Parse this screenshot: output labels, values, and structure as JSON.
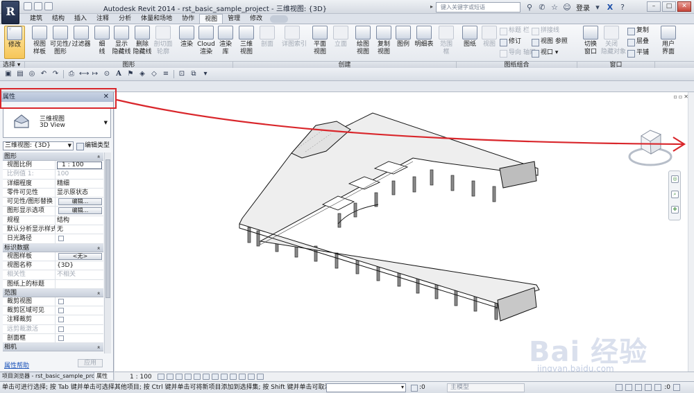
{
  "title": {
    "text": "Autodesk Revit 2014 -     rst_basic_sample_project - 三维视图: {3D}",
    "search_placeholder": "键入关键字或短语",
    "login": "登录"
  },
  "tabs": [
    "建筑",
    "结构",
    "插入",
    "注释",
    "分析",
    "体量和场地",
    "协作",
    "视图",
    "管理",
    "修改"
  ],
  "active_tab": "视图",
  "ribbon": {
    "select": {
      "modify": "修改",
      "dropdown": "选择 ▾"
    },
    "graphics": {
      "buttons": [
        "视图\n样板",
        "可见性/\n图形",
        "过滤器",
        "细\n线",
        "显示\n隐藏线",
        "删除\n隐藏线",
        "剖切面\n轮廓",
        "渲染",
        "Cloud\n渲染",
        "渲染\n库"
      ],
      "label": "图形"
    },
    "create": {
      "buttons": [
        "三维\n视图",
        "剖面",
        "详图索引",
        "平面\n视图",
        "立面",
        "绘图\n视图",
        "复制\n视图",
        "图例",
        "明细表",
        "范围\n框"
      ],
      "label": "创建"
    },
    "sheet": {
      "big": [
        "图纸",
        "视图"
      ],
      "small": [
        "标题 栏",
        "修订",
        "导向 轴网",
        "拼接线",
        "视图 参照",
        "视口 ▾"
      ],
      "label": "图纸组合"
    },
    "window": {
      "big": [
        "切换\n窗口",
        "关闭\n隐藏对象"
      ],
      "small": [
        "复制",
        "层叠",
        "平铺"
      ],
      "label": "窗口"
    },
    "user": {
      "label": "用户\n界面"
    }
  },
  "properties": {
    "title": "属性",
    "type_name_cn": "三维视图",
    "type_name_en": "3D View",
    "view_selector": "三维视图: {3D}",
    "edit_type": "编辑类型",
    "sections": [
      {
        "name": "图形",
        "rows": [
          {
            "k": "视图比例",
            "v": "1 : 100",
            "kind": "input"
          },
          {
            "k": "比例值 1:",
            "v": "100",
            "kind": "dim"
          },
          {
            "k": "详细程度",
            "v": "精细"
          },
          {
            "k": "零件可见性",
            "v": "显示原状态"
          },
          {
            "k": "可见性/图形替换",
            "v": "编辑...",
            "kind": "button"
          },
          {
            "k": "图形显示选项",
            "v": "编辑...",
            "kind": "button"
          },
          {
            "k": "规程",
            "v": "结构"
          },
          {
            "k": "默认分析显示样式",
            "v": "无"
          },
          {
            "k": "日光路径",
            "v": "",
            "kind": "check"
          }
        ]
      },
      {
        "name": "标识数据",
        "rows": [
          {
            "k": "视图样板",
            "v": "<无>",
            "kind": "button"
          },
          {
            "k": "视图名称",
            "v": "{3D}"
          },
          {
            "k": "相关性",
            "v": "不相关",
            "kind": "dim"
          },
          {
            "k": "图纸上的标题",
            "v": ""
          }
        ]
      },
      {
        "name": "范围",
        "rows": [
          {
            "k": "裁剪视图",
            "v": "",
            "kind": "check"
          },
          {
            "k": "裁剪区域可见",
            "v": "",
            "kind": "check"
          },
          {
            "k": "注释裁剪",
            "v": "",
            "kind": "check"
          },
          {
            "k": "远剪裁激活",
            "v": "",
            "kind": "check-dim"
          },
          {
            "k": "剖面框",
            "v": "",
            "kind": "check"
          }
        ]
      },
      {
        "name": "相机",
        "rows": []
      }
    ],
    "help": "属性帮助",
    "apply": "应用",
    "bottom_tabs": [
      "项目浏览器 - rst_basic_sample_project",
      "属性"
    ]
  },
  "view": {
    "scale": "1 : 100"
  },
  "status": {
    "text": "单击可进行选择; 按 Tab 键并单击可选择其他项目; 按 Ctrl 键并单击可将新项目添加到选择集; 按 Shift 键并单击可取消选择",
    "zero": ":0",
    "model": "主模型",
    "zero_right": ":0"
  },
  "watermark": {
    "big": "Bai 经验",
    "small": "jingyan.baidu.com"
  },
  "annotation": {
    "color": "#d9262b"
  }
}
